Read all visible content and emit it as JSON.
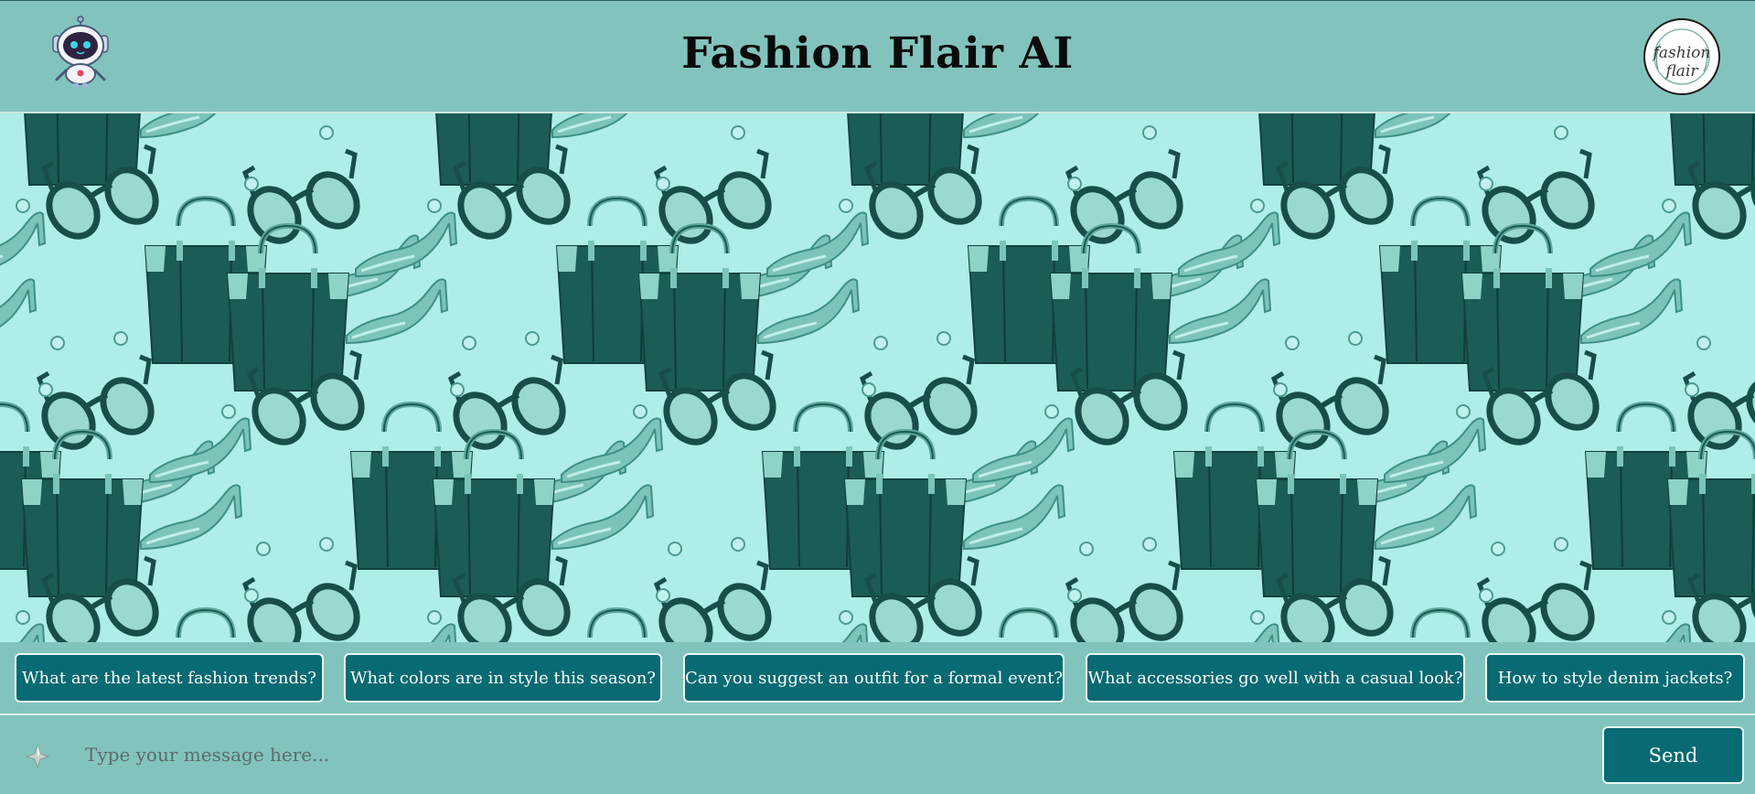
{
  "app": {
    "title": "Fashion Flair AI",
    "brand_logo_text": "fashion flair",
    "mascot_icon": "robot-icon"
  },
  "colors": {
    "header_bg": "#82c4bd",
    "pattern_bg": "#aeede8",
    "accent": "#086a72",
    "dark_green": "#1b5c56"
  },
  "suggestions": [
    {
      "label": "What are the latest fashion trends?"
    },
    {
      "label": "What colors are in style this season?"
    },
    {
      "label": "Can you suggest an outfit for a formal event?"
    },
    {
      "label": "What accessories go well with a casual look?"
    },
    {
      "label": "How to style denim jackets?"
    }
  ],
  "composer": {
    "placeholder": "Type your message here...",
    "value": "",
    "send_label": "Send",
    "icon": "sparkle-icon"
  }
}
